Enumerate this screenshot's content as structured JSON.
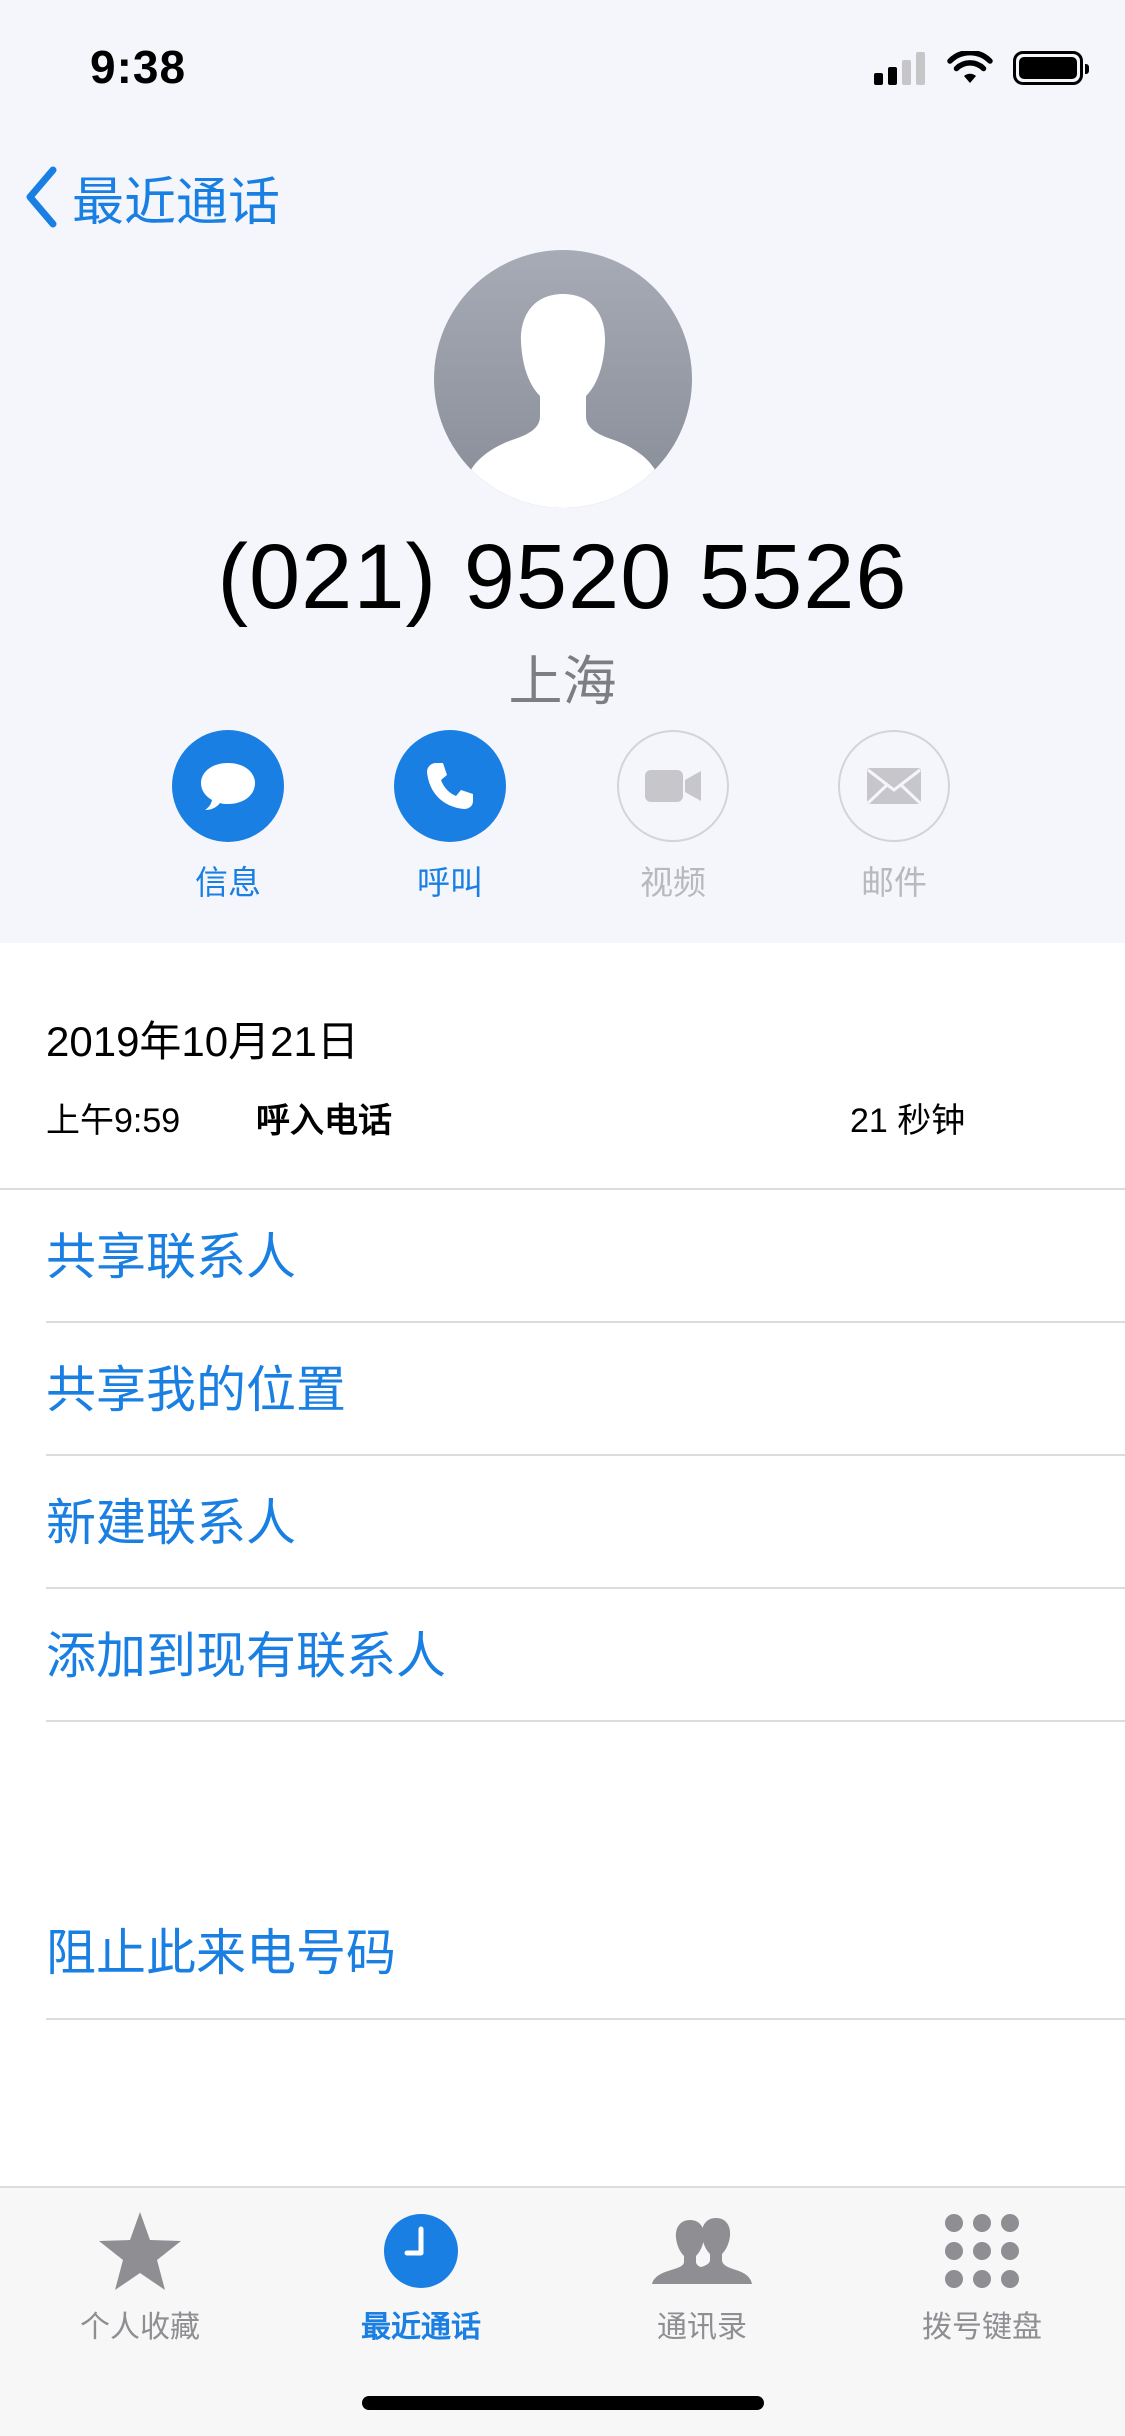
{
  "status_bar": {
    "time": "9:38"
  },
  "nav": {
    "back_label": "最近通话"
  },
  "contact": {
    "number": "(021) 9520 5526",
    "location": "上海"
  },
  "actions": [
    {
      "label": "信息",
      "icon": "message-bubble-icon",
      "enabled": true
    },
    {
      "label": "呼叫",
      "icon": "phone-icon",
      "enabled": true
    },
    {
      "label": "视频",
      "icon": "video-camera-icon",
      "enabled": false
    },
    {
      "label": "邮件",
      "icon": "envelope-icon",
      "enabled": false
    }
  ],
  "call_record": {
    "date": "2019年10月21日",
    "time": "上午9:59",
    "type": "呼入电话",
    "duration": "21 秒钟"
  },
  "menu": {
    "items": [
      "共享联系人",
      "共享我的位置",
      "新建联系人",
      "添加到现有联系人"
    ],
    "block": "阻止此来电号码"
  },
  "tabbar": {
    "tabs": [
      {
        "label": "个人收藏",
        "icon": "star-icon",
        "active": false
      },
      {
        "label": "最近通话",
        "icon": "clock-icon",
        "active": true
      },
      {
        "label": "通讯录",
        "icon": "contacts-icon",
        "active": false
      },
      {
        "label": "拨号键盘",
        "icon": "keypad-icon",
        "active": false
      }
    ]
  },
  "colors": {
    "accent": "#1a7fe2",
    "header_bg": "#f4f6fc",
    "disabled": "#b8b8bd"
  }
}
